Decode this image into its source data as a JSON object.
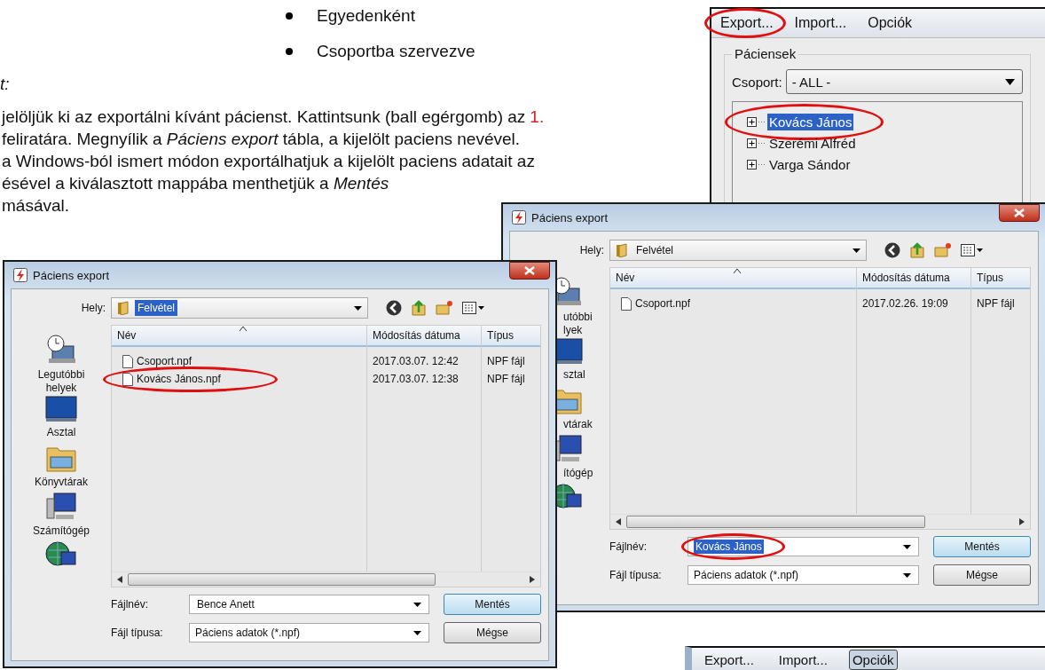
{
  "bullets": [
    "Egyedenként",
    "Csoportba szervezve"
  ],
  "heading": "t:",
  "paragraph_lines": [
    {
      "text": "jelöljük ki az exportálni kívánt pácienst. Kattintsunk (ball egérgomb) az",
      "step_number": "1."
    },
    {
      "text": "feliratára. Megnyílik a *Páciens export* tábla, a kijelölt paciens nevével."
    },
    {
      "text": "a Windows-ból ismert módon exportálhatjuk a kijelölt paciens adatait az"
    },
    {
      "text": "ésével a kiválasztott mappába menthetjük a *Mentés*"
    },
    {
      "text": "másával."
    }
  ],
  "patient_window": {
    "menu": [
      {
        "label": "Export...",
        "selected": false,
        "circled": true
      },
      {
        "label": "Import...",
        "selected": false,
        "circled": false
      },
      {
        "label": "Opciók",
        "selected": false,
        "circled": false
      }
    ],
    "group_title": "Páciensek",
    "group_label": "Csoport:",
    "group_value": "- ALL -",
    "patients": [
      {
        "name": "Kovács János",
        "selected": true,
        "expanded": false,
        "circled": true
      },
      {
        "name": "Szerémi Alfréd",
        "selected": false,
        "expanded": false,
        "circled": false
      },
      {
        "name": "Varga Sándor",
        "selected": false,
        "expanded": false,
        "circled": false
      }
    ]
  },
  "dialogs": [
    {
      "title": "Páciens export",
      "location_label": "Hely:",
      "location": "Felvétel",
      "location_selected": true,
      "places": [
        {
          "kind": "recent",
          "lines": [
            "Legutóbbi",
            "helyek"
          ]
        },
        {
          "kind": "desktop",
          "lines": [
            "Asztal"
          ]
        },
        {
          "kind": "libraries",
          "lines": [
            "Könyvtárak"
          ]
        },
        {
          "kind": "computer",
          "lines": [
            "Számítógép"
          ]
        },
        {
          "kind": "network"
        }
      ],
      "columns": [
        "Név",
        "Módosítás dátuma",
        "Típus"
      ],
      "files": [
        {
          "name": "Csoport.npf",
          "date": "2017.03.07. 12:42",
          "type": "NPF fájl",
          "circled": false
        },
        {
          "name": "Kovács János.npf",
          "date": "2017.03.07. 12:38",
          "type": "NPF fájl",
          "circled": true
        }
      ],
      "filename_label": "Fájlnév:",
      "filename": "Bence Anett",
      "filename_selected": false,
      "filename_circled": false,
      "filetype_label": "Fájl típusa:",
      "filetype": "Páciens adatok (*.npf)",
      "buttons": [
        "Mentés",
        "Mégse"
      ]
    },
    {
      "title": "Páciens export",
      "location_label": "Hely:",
      "location": "Felvétel",
      "location_selected": false,
      "places": [
        {
          "kind": "recent",
          "lines": [
            "utóbbi",
            "lyek"
          ]
        },
        {
          "kind": "desktop",
          "lines": [
            "sztal"
          ]
        },
        {
          "kind": "libraries",
          "lines": [
            "vtárak"
          ]
        },
        {
          "kind": "computer",
          "lines": [
            "ítógép"
          ]
        },
        {
          "kind": "network"
        }
      ],
      "columns": [
        "Név",
        "Módosítás dátuma",
        "Típus"
      ],
      "files": [
        {
          "name": "Csoport.npf",
          "date": "2017.02.26. 19:09",
          "type": "NPF fájl",
          "circled": false
        }
      ],
      "filename_label": "Fájlnév:",
      "filename": "Kovács János",
      "filename_selected": true,
      "filename_circled": true,
      "filetype_label": "Fájl típusa:",
      "filetype": "Páciens adatok (*.npf)",
      "buttons": [
        "Mentés",
        "Mégse"
      ]
    }
  ],
  "bottom_window": {
    "menu": [
      {
        "label": "Export...",
        "selected": false
      },
      {
        "label": "Import...",
        "selected": false
      },
      {
        "label": "Opciók",
        "selected": true
      }
    ]
  }
}
